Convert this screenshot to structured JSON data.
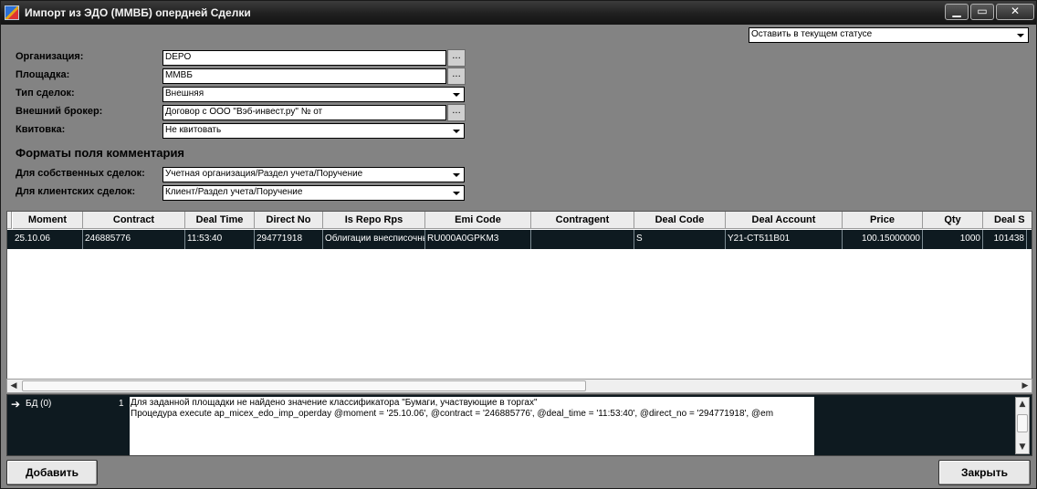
{
  "window": {
    "title": "Импорт из ЭДО (ММВБ) опердней Сделки",
    "minimize_label": "▁",
    "maximize_label": "▭",
    "close_label": "✕"
  },
  "status_combo": {
    "value": "Оставить в текущем статусе"
  },
  "form": {
    "organization": {
      "label": "Организация:",
      "value": "DEPO"
    },
    "platform": {
      "label": "Площадка:",
      "value": "ММВБ"
    },
    "deal_type": {
      "label": "Тип сделок:",
      "value": "Внешняя"
    },
    "external_broker": {
      "label": "Внешний брокер:",
      "value": "Договор с ООО \"Вэб-инвест.ру\" №  от"
    },
    "kvitovka": {
      "label": "Квитовка:",
      "value": "Не квитовать"
    },
    "dots_label": "..."
  },
  "formats": {
    "title": "Форматы поля комментария",
    "own_deals": {
      "label": "Для собственных сделок:",
      "value": "Учетная организация/Раздел учета/Поручение"
    },
    "client_deals": {
      "label": "Для клиентских сделок:",
      "value": "Клиент/Раздел учета/Поручение"
    }
  },
  "grid": {
    "columns": [
      "Moment",
      "Contract",
      "Deal Time",
      "Direct No",
      "Is Repo Rps",
      "Emi Code",
      "Contragent",
      "Deal Code",
      "Deal Account",
      "Price",
      "Qty",
      "Deal S"
    ],
    "rows": [
      [
        "25.10.06",
        "246885776",
        "11:53:40",
        "294771918",
        "Облигации внесписочные",
        "RU000A0GPKM3",
        "",
        "S",
        "Y21-CT511B01",
        "100.15000000",
        "1000",
        "101438"
      ]
    ]
  },
  "log": {
    "arrow": "➔",
    "source": "БД (0)",
    "count": "1",
    "line1": "Для заданной площадки не найдено значение классификатора \"Бумаги, участвующие в торгах\"",
    "line2": "Процедура execute ap_micex_edo_imp_operday @moment = '25.10.06', @contract = '246885776', @deal_time = '11:53:40', @direct_no = '294771918', @em"
  },
  "buttons": {
    "add": "Добавить",
    "close": "Закрыть"
  }
}
